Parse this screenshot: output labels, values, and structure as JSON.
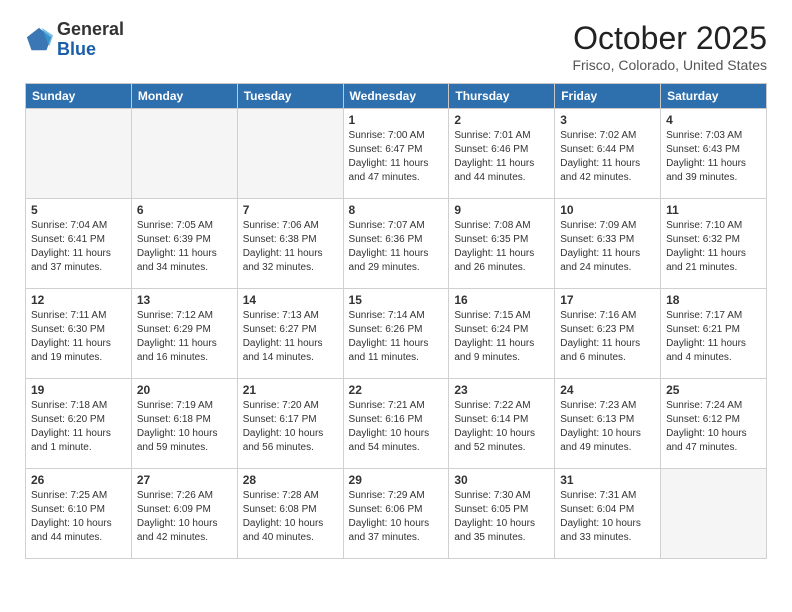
{
  "header": {
    "logo_general": "General",
    "logo_blue": "Blue",
    "month_title": "October 2025",
    "location": "Frisco, Colorado, United States"
  },
  "weekdays": [
    "Sunday",
    "Monday",
    "Tuesday",
    "Wednesday",
    "Thursday",
    "Friday",
    "Saturday"
  ],
  "weeks": [
    [
      {
        "day": "",
        "info": ""
      },
      {
        "day": "",
        "info": ""
      },
      {
        "day": "",
        "info": ""
      },
      {
        "day": "1",
        "info": "Sunrise: 7:00 AM\nSunset: 6:47 PM\nDaylight: 11 hours\nand 47 minutes."
      },
      {
        "day": "2",
        "info": "Sunrise: 7:01 AM\nSunset: 6:46 PM\nDaylight: 11 hours\nand 44 minutes."
      },
      {
        "day": "3",
        "info": "Sunrise: 7:02 AM\nSunset: 6:44 PM\nDaylight: 11 hours\nand 42 minutes."
      },
      {
        "day": "4",
        "info": "Sunrise: 7:03 AM\nSunset: 6:43 PM\nDaylight: 11 hours\nand 39 minutes."
      }
    ],
    [
      {
        "day": "5",
        "info": "Sunrise: 7:04 AM\nSunset: 6:41 PM\nDaylight: 11 hours\nand 37 minutes."
      },
      {
        "day": "6",
        "info": "Sunrise: 7:05 AM\nSunset: 6:39 PM\nDaylight: 11 hours\nand 34 minutes."
      },
      {
        "day": "7",
        "info": "Sunrise: 7:06 AM\nSunset: 6:38 PM\nDaylight: 11 hours\nand 32 minutes."
      },
      {
        "day": "8",
        "info": "Sunrise: 7:07 AM\nSunset: 6:36 PM\nDaylight: 11 hours\nand 29 minutes."
      },
      {
        "day": "9",
        "info": "Sunrise: 7:08 AM\nSunset: 6:35 PM\nDaylight: 11 hours\nand 26 minutes."
      },
      {
        "day": "10",
        "info": "Sunrise: 7:09 AM\nSunset: 6:33 PM\nDaylight: 11 hours\nand 24 minutes."
      },
      {
        "day": "11",
        "info": "Sunrise: 7:10 AM\nSunset: 6:32 PM\nDaylight: 11 hours\nand 21 minutes."
      }
    ],
    [
      {
        "day": "12",
        "info": "Sunrise: 7:11 AM\nSunset: 6:30 PM\nDaylight: 11 hours\nand 19 minutes."
      },
      {
        "day": "13",
        "info": "Sunrise: 7:12 AM\nSunset: 6:29 PM\nDaylight: 11 hours\nand 16 minutes."
      },
      {
        "day": "14",
        "info": "Sunrise: 7:13 AM\nSunset: 6:27 PM\nDaylight: 11 hours\nand 14 minutes."
      },
      {
        "day": "15",
        "info": "Sunrise: 7:14 AM\nSunset: 6:26 PM\nDaylight: 11 hours\nand 11 minutes."
      },
      {
        "day": "16",
        "info": "Sunrise: 7:15 AM\nSunset: 6:24 PM\nDaylight: 11 hours\nand 9 minutes."
      },
      {
        "day": "17",
        "info": "Sunrise: 7:16 AM\nSunset: 6:23 PM\nDaylight: 11 hours\nand 6 minutes."
      },
      {
        "day": "18",
        "info": "Sunrise: 7:17 AM\nSunset: 6:21 PM\nDaylight: 11 hours\nand 4 minutes."
      }
    ],
    [
      {
        "day": "19",
        "info": "Sunrise: 7:18 AM\nSunset: 6:20 PM\nDaylight: 11 hours\nand 1 minute."
      },
      {
        "day": "20",
        "info": "Sunrise: 7:19 AM\nSunset: 6:18 PM\nDaylight: 10 hours\nand 59 minutes."
      },
      {
        "day": "21",
        "info": "Sunrise: 7:20 AM\nSunset: 6:17 PM\nDaylight: 10 hours\nand 56 minutes."
      },
      {
        "day": "22",
        "info": "Sunrise: 7:21 AM\nSunset: 6:16 PM\nDaylight: 10 hours\nand 54 minutes."
      },
      {
        "day": "23",
        "info": "Sunrise: 7:22 AM\nSunset: 6:14 PM\nDaylight: 10 hours\nand 52 minutes."
      },
      {
        "day": "24",
        "info": "Sunrise: 7:23 AM\nSunset: 6:13 PM\nDaylight: 10 hours\nand 49 minutes."
      },
      {
        "day": "25",
        "info": "Sunrise: 7:24 AM\nSunset: 6:12 PM\nDaylight: 10 hours\nand 47 minutes."
      }
    ],
    [
      {
        "day": "26",
        "info": "Sunrise: 7:25 AM\nSunset: 6:10 PM\nDaylight: 10 hours\nand 44 minutes."
      },
      {
        "day": "27",
        "info": "Sunrise: 7:26 AM\nSunset: 6:09 PM\nDaylight: 10 hours\nand 42 minutes."
      },
      {
        "day": "28",
        "info": "Sunrise: 7:28 AM\nSunset: 6:08 PM\nDaylight: 10 hours\nand 40 minutes."
      },
      {
        "day": "29",
        "info": "Sunrise: 7:29 AM\nSunset: 6:06 PM\nDaylight: 10 hours\nand 37 minutes."
      },
      {
        "day": "30",
        "info": "Sunrise: 7:30 AM\nSunset: 6:05 PM\nDaylight: 10 hours\nand 35 minutes."
      },
      {
        "day": "31",
        "info": "Sunrise: 7:31 AM\nSunset: 6:04 PM\nDaylight: 10 hours\nand 33 minutes."
      },
      {
        "day": "",
        "info": ""
      }
    ]
  ]
}
